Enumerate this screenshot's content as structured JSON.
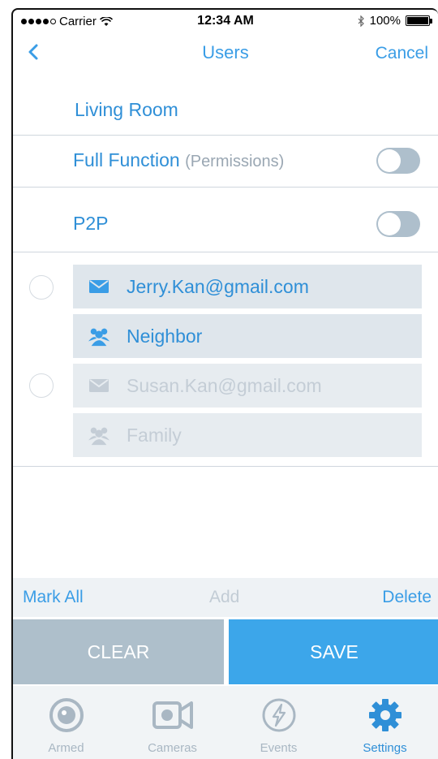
{
  "status": {
    "carrier": "Carrier",
    "time": "12:34 AM",
    "battery": "100%"
  },
  "nav": {
    "title": "Users",
    "cancel": "Cancel"
  },
  "room": "Living Room",
  "permissions": {
    "full_function_label": "Full Function",
    "full_function_sub": "(Permissions)",
    "p2p_label": "P2P"
  },
  "users": [
    {
      "email": "Jerry.Kan@gmail.com",
      "group": "Neighbor"
    },
    {
      "email": "Susan.Kan@gmail.com",
      "group": "Family"
    }
  ],
  "actions": {
    "mark_all": "Mark All",
    "add": "Add",
    "delete": "Delete"
  },
  "buttons": {
    "clear": "CLEAR",
    "save": "SAVE"
  },
  "tabs": [
    {
      "label": "Armed",
      "icon": "armed-icon"
    },
    {
      "label": "Cameras",
      "icon": "camera-icon"
    },
    {
      "label": "Events",
      "icon": "events-icon"
    },
    {
      "label": "Settings",
      "icon": "gear-icon"
    }
  ],
  "colors": {
    "accent": "#3a9de6",
    "muted": "#aebfcc",
    "save": "#3ca6ea"
  }
}
